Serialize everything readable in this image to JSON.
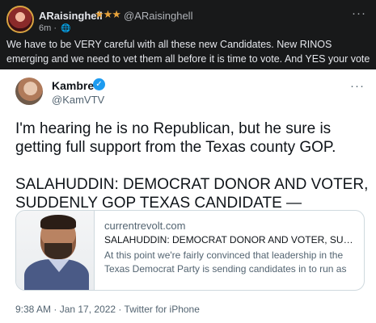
{
  "post": {
    "author_name": "ARaisinghell",
    "author_stars": "★★★",
    "author_handle": "@ARaisinghell",
    "time": "6m",
    "separator": "·",
    "visibility_icon": "globe-icon",
    "more_label": "···",
    "text": "We have to be VERY careful with all these new Candidates. New RINOS emerging and we need to vet them all before it is time to vote. And YES your vote DOES MATTER"
  },
  "tweet": {
    "author_name": "Kambree",
    "verified_icon": "verified-badge-icon",
    "author_handle": "@KamVTV",
    "more_label": "···",
    "paragraph_1": "I'm hearing he is no Republican, but he sure is getting full support from the Texas county GOP.",
    "paragraph_2": "SALAHUDDIN: DEMOCRAT DONOR AND VOTER, SUDDENLY GOP TEXAS CANDIDATE —",
    "link_card": {
      "domain": "currentrevolt.com",
      "title": "SALAHUDDIN: DEMOCRAT DONOR AND VOTER, SUDDEN...",
      "description": "At this point we're fairly convinced that leadership in the Texas Democrat Party is sending candidates in to run as G..."
    },
    "footer": "9:38 AM · Jan 17, 2022 · Twitter for iPhone"
  },
  "colors": {
    "dark_bg": "#18191a",
    "star_color": "#e8a33b",
    "verified_blue": "#1d9bf0",
    "muted_text": "#536471"
  }
}
